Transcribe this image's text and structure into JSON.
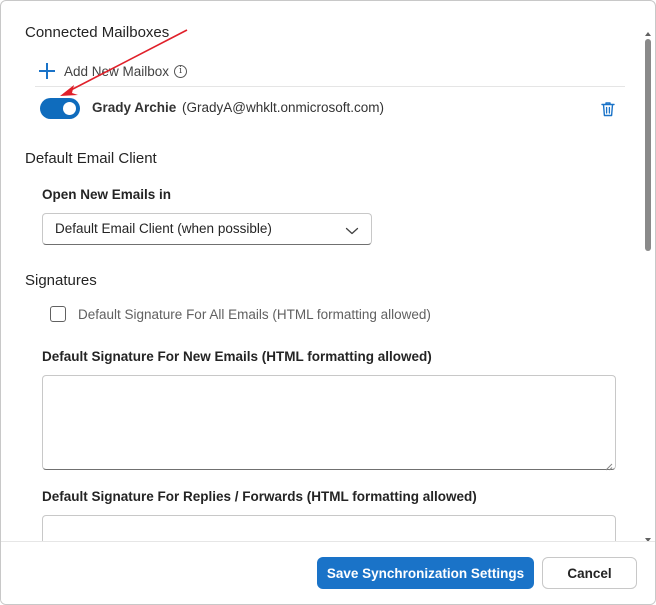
{
  "sections": {
    "connected_mailboxes": "Connected Mailboxes",
    "default_email_client": "Default Email Client",
    "signatures": "Signatures"
  },
  "mailboxes": {
    "add_label": "Add New Mailbox",
    "info_glyph": "i",
    "items": [
      {
        "name": "Grady Archie",
        "email": "(GradyA@whklt.onmicrosoft.com)",
        "enabled": true
      }
    ]
  },
  "email_client": {
    "label": "Open New Emails in",
    "selected": "Default Email Client (when possible)"
  },
  "signatures": {
    "default_all_label": "Default Signature For All Emails (HTML formatting allowed)",
    "default_all_checked": false,
    "new_emails_label": "Default Signature For New Emails (HTML formatting allowed)",
    "new_emails_value": "",
    "replies_label": "Default Signature For Replies / Forwards (HTML formatting allowed)",
    "replies_value": ""
  },
  "footer": {
    "save_label": "Save Synchronization Settings",
    "cancel_label": "Cancel"
  },
  "colors": {
    "accent": "#1a73c8",
    "toggle_on": "#0f6cbd",
    "annotation_arrow": "#e0202a"
  },
  "icons": {
    "add": "plus-icon",
    "info": "info-icon",
    "delete": "trash-icon",
    "dropdown": "chevron-down-icon"
  }
}
